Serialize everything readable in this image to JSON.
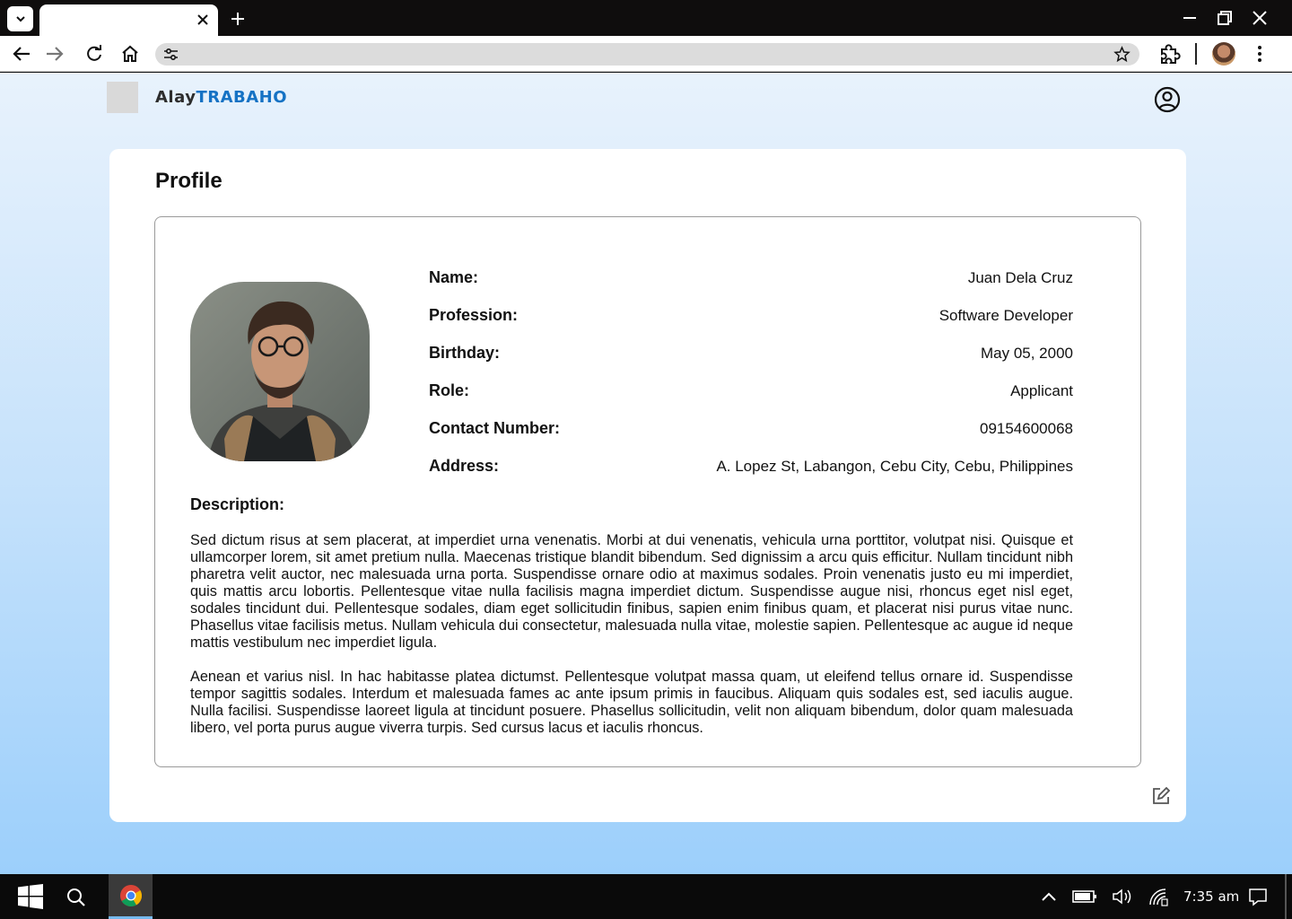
{
  "browser": {
    "tab_title": "",
    "address": ""
  },
  "header": {
    "brand_part1": "Alay",
    "brand_part2": "TRABAHO",
    "brand_colors": {
      "primary": "#2d2d2d",
      "accent": "#1572c4"
    }
  },
  "profile": {
    "title": "Profile",
    "fields": [
      {
        "label": "Name:",
        "value": "Juan Dela Cruz"
      },
      {
        "label": "Profession:",
        "value": "Software Developer"
      },
      {
        "label": "Birthday:",
        "value": "May 05, 2000"
      },
      {
        "label": "Role:",
        "value": "Applicant"
      },
      {
        "label": "Contact Number:",
        "value": "09154600068"
      },
      {
        "label": "Address:",
        "value": "A. Lopez St, Labangon, Cebu City, Cebu, Philippines"
      }
    ],
    "description_label": "Description:",
    "description": [
      "Sed dictum risus at sem placerat, at imperdiet urna venenatis. Morbi at dui venenatis, vehicula urna porttitor, volutpat nisi. Quisque et ullamcorper lorem, sit amet pretium nulla. Maecenas tristique blandit bibendum. Sed dignissim a arcu quis efficitur. Nullam tincidunt nibh pharetra velit auctor, nec malesuada urna porta. Suspendisse ornare odio at maximus sodales. Proin venenatis justo eu mi imperdiet, quis mattis arcu lobortis. Pellentesque vitae nulla facilisis magna imperdiet dictum. Suspendisse augue nisi, rhoncus eget nisl eget, sodales tincidunt dui. Pellentesque sodales, diam eget sollicitudin finibus, sapien enim finibus quam, et placerat nisi purus vitae nunc. Phasellus vitae facilisis metus. Nullam vehicula dui consectetur, malesuada nulla vitae, molestie sapien. Pellentesque ac augue id neque mattis vestibulum nec imperdiet ligula.",
      "Aenean et varius nisl. In hac habitasse platea dictumst. Pellentesque volutpat massa quam, ut eleifend tellus ornare id. Suspendisse tempor sagittis sodales. Interdum et malesuada fames ac ante ipsum primis in faucibus. Aliquam quis sodales est, sed iaculis augue. Nulla facilisi. Suspendisse laoreet ligula at tincidunt posuere. Phasellus sollicitudin, velit non aliquam bibendum, dolor quam malesuada libero, vel porta purus augue viverra turpis. Sed cursus lacus et iaculis rhoncus."
    ],
    "edit_icon": "edit-icon"
  },
  "taskbar": {
    "time": "7:35 am"
  }
}
